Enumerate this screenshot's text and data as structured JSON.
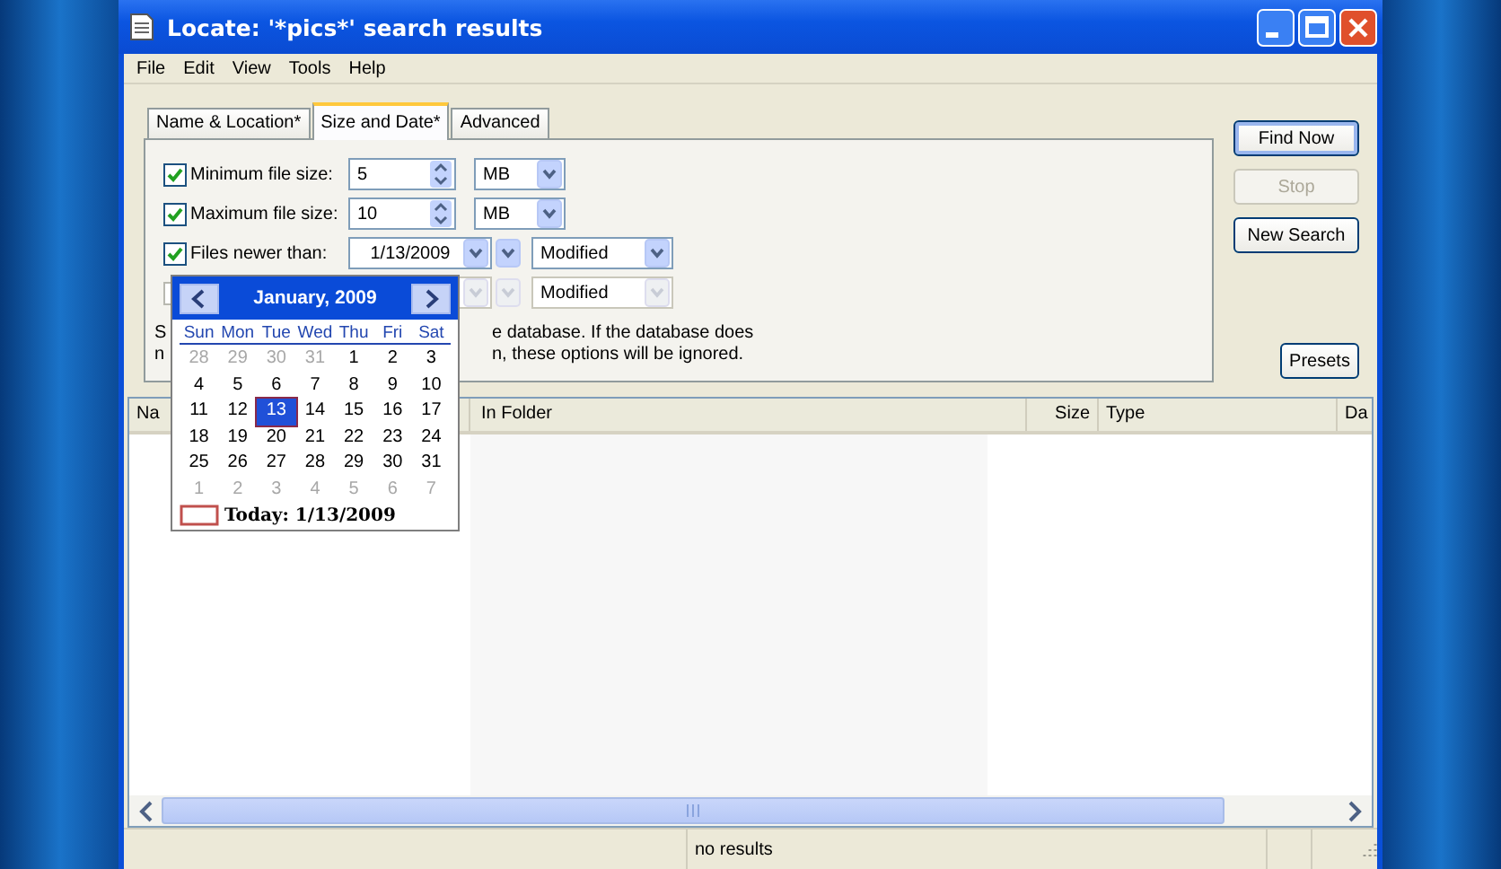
{
  "window": {
    "title": "Locate: '*pics*' search results"
  },
  "menu": [
    "File",
    "Edit",
    "View",
    "Tools",
    "Help"
  ],
  "tabs": [
    {
      "label": "Name & Location*",
      "selected": false
    },
    {
      "label": "Size and Date*",
      "selected": true
    },
    {
      "label": "Advanced",
      "selected": false
    }
  ],
  "criteria": [
    {
      "kind": "size",
      "label": "Minimum file size:",
      "checked": true,
      "disabled": false,
      "value": "5",
      "unit": "MB"
    },
    {
      "kind": "size",
      "label": "Maximum file size:",
      "checked": true,
      "disabled": false,
      "value": "10",
      "unit": "MB"
    },
    {
      "kind": "date",
      "label": "Files newer than:",
      "checked": true,
      "disabled": false,
      "value": "1/13/2009",
      "field": "Modified"
    },
    {
      "kind": "date",
      "checked": false,
      "disabled": true,
      "field": "Modified"
    }
  ],
  "hint_lines": [
    {
      "start": "S",
      "end": "e database. If the database does"
    },
    {
      "start": "n",
      "end": "n, these options will be ignored."
    }
  ],
  "buttons": [
    {
      "label": "Find Now",
      "disabled": false,
      "default": true
    },
    {
      "label": "Stop",
      "disabled": true,
      "default": false
    },
    {
      "label": "New Search",
      "disabled": false,
      "default": false
    }
  ],
  "presets_button": "Presets",
  "columns": [
    "Na",
    "In Folder",
    "Size",
    "Type",
    "Da"
  ],
  "calendar": {
    "month": "January, 2009",
    "weekdays": [
      "Sun",
      "Mon",
      "Tue",
      "Wed",
      "Thu",
      "Fri",
      "Sat"
    ],
    "days": [
      {
        "day": "28",
        "muted": true,
        "selected": false
      },
      {
        "day": "29",
        "muted": true,
        "selected": false
      },
      {
        "day": "30",
        "muted": true,
        "selected": false
      },
      {
        "day": "31",
        "muted": true,
        "selected": false
      },
      {
        "day": "1",
        "muted": false,
        "selected": false
      },
      {
        "day": "2",
        "muted": false,
        "selected": false
      },
      {
        "day": "3",
        "muted": false,
        "selected": false
      },
      {
        "day": "4",
        "muted": false,
        "selected": false
      },
      {
        "day": "5",
        "muted": false,
        "selected": false
      },
      {
        "day": "6",
        "muted": false,
        "selected": false
      },
      {
        "day": "7",
        "muted": false,
        "selected": false
      },
      {
        "day": "8",
        "muted": false,
        "selected": false
      },
      {
        "day": "9",
        "muted": false,
        "selected": false
      },
      {
        "day": "10",
        "muted": false,
        "selected": false
      },
      {
        "day": "11",
        "muted": false,
        "selected": false
      },
      {
        "day": "12",
        "muted": false,
        "selected": false
      },
      {
        "day": "13",
        "muted": false,
        "selected": true
      },
      {
        "day": "14",
        "muted": false,
        "selected": false
      },
      {
        "day": "15",
        "muted": false,
        "selected": false
      },
      {
        "day": "16",
        "muted": false,
        "selected": false
      },
      {
        "day": "17",
        "muted": false,
        "selected": false
      },
      {
        "day": "18",
        "muted": false,
        "selected": false
      },
      {
        "day": "19",
        "muted": false,
        "selected": false
      },
      {
        "day": "20",
        "muted": false,
        "selected": false
      },
      {
        "day": "21",
        "muted": false,
        "selected": false
      },
      {
        "day": "22",
        "muted": false,
        "selected": false
      },
      {
        "day": "23",
        "muted": false,
        "selected": false
      },
      {
        "day": "24",
        "muted": false,
        "selected": false
      },
      {
        "day": "25",
        "muted": false,
        "selected": false
      },
      {
        "day": "26",
        "muted": false,
        "selected": false
      },
      {
        "day": "27",
        "muted": false,
        "selected": false
      },
      {
        "day": "28",
        "muted": false,
        "selected": false
      },
      {
        "day": "29",
        "muted": false,
        "selected": false
      },
      {
        "day": "30",
        "muted": false,
        "selected": false
      },
      {
        "day": "31",
        "muted": false,
        "selected": false
      },
      {
        "day": "1",
        "muted": true,
        "selected": false
      },
      {
        "day": "2",
        "muted": true,
        "selected": false
      },
      {
        "day": "3",
        "muted": true,
        "selected": false
      },
      {
        "day": "4",
        "muted": true,
        "selected": false
      },
      {
        "day": "5",
        "muted": true,
        "selected": false
      },
      {
        "day": "6",
        "muted": true,
        "selected": false
      },
      {
        "day": "7",
        "muted": true,
        "selected": false
      }
    ],
    "today": "Today: 1/13/2009"
  },
  "status_bar": "no results"
}
